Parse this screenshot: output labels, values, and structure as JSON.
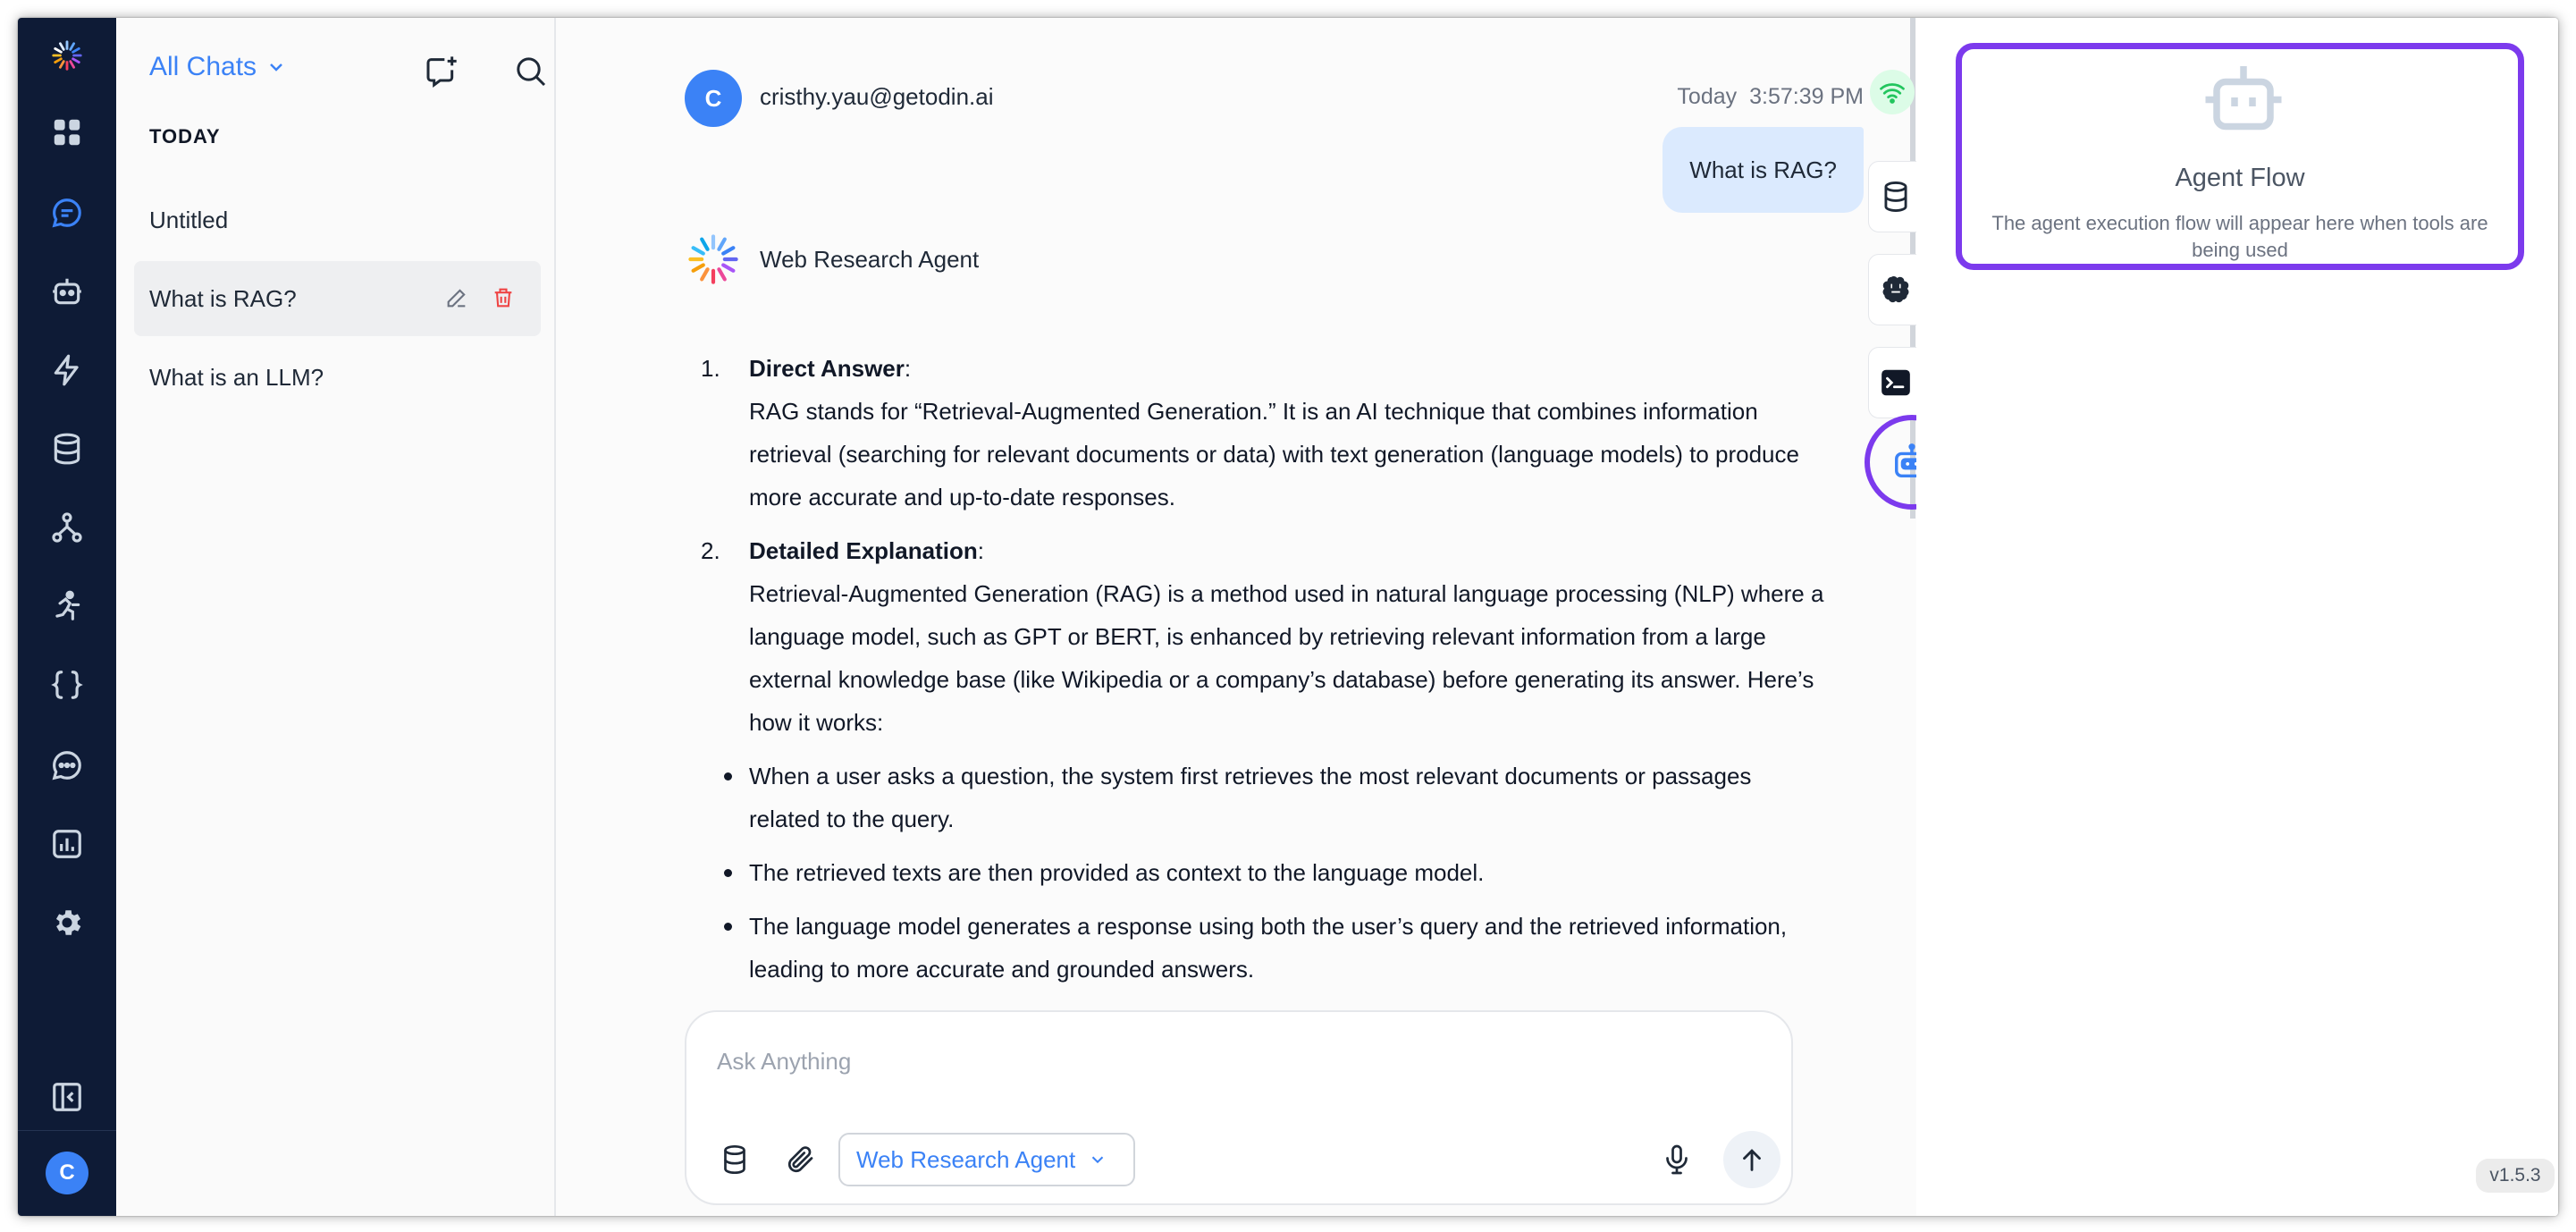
{
  "sidebar": {
    "items": [
      {
        "icon": "logo-icon"
      },
      {
        "icon": "grid-icon"
      },
      {
        "icon": "chat-icon",
        "active": true
      },
      {
        "icon": "robot-icon"
      },
      {
        "icon": "lightning-icon"
      },
      {
        "icon": "database-icon"
      },
      {
        "icon": "workflow-icon"
      },
      {
        "icon": "runner-icon"
      },
      {
        "icon": "code-braces-icon"
      },
      {
        "icon": "message-dots-icon"
      },
      {
        "icon": "analytics-icon"
      },
      {
        "icon": "gear-icon"
      }
    ],
    "collapse_icon": "collapse-sidebar-icon",
    "avatar_initial": "C",
    "colors": {
      "background": "#0e1b36",
      "active": "#3b82f6",
      "icon": "#cbd5e1"
    }
  },
  "chat_list": {
    "filter_label": "All Chats",
    "new_chat_icon": "new-chat-icon",
    "search_icon": "search-icon",
    "section_label": "TODAY",
    "chats": [
      {
        "title": "Untitled"
      },
      {
        "title": "What is RAG?",
        "active": true
      },
      {
        "title": "What is an LLM?"
      }
    ]
  },
  "conversation": {
    "user_initial": "C",
    "user_email": "cristhy.yau@getodin.ai",
    "time_day": "Today",
    "time_clock": "3:57:39 PM",
    "user_message": "What is RAG?",
    "agent_name": "Web Research Agent",
    "answer": {
      "item1_num": "1.",
      "item1_title": "Direct Answer",
      "item1_colon": ":",
      "item1_text": "RAG stands for “Retrieval-Augmented Generation.” It is an AI technique that combines information retrieval (searching for relevant documents or data) with text generation (language models) to produce more accurate and up-to-date responses.",
      "item2_num": "2.",
      "item2_title": "Detailed Explanation",
      "item2_colon": ":",
      "item2_text": "Retrieval-Augmented Generation (RAG) is a method used in natural language processing (NLP) where a language model, such as GPT or BERT, is enhanced by retrieving relevant information from a large external knowledge base (like Wikipedia or a company’s database) before generating its answer. Here’s how it works:",
      "bullets": [
        "When a user asks a question, the system first retrieves the most relevant documents or passages related to the query.",
        "The retrieved texts are then provided as context to the language model.",
        "The language model generates a response using both the user’s query and the retrieved information, leading to more accurate and grounded answers."
      ]
    }
  },
  "composer": {
    "placeholder": "Ask Anything",
    "agent_selector": "Web Research Agent"
  },
  "tool_strip": {
    "items": [
      "wifi-icon",
      "database-icon",
      "brain-icon",
      "terminal-icon",
      "robot-icon"
    ],
    "status_color": "#22c55e",
    "highlight_color": "#7c3aed"
  },
  "agent_flow": {
    "title": "Agent Flow",
    "description": "The agent execution flow will appear here when tools are being used"
  },
  "version": "v1.5.3"
}
